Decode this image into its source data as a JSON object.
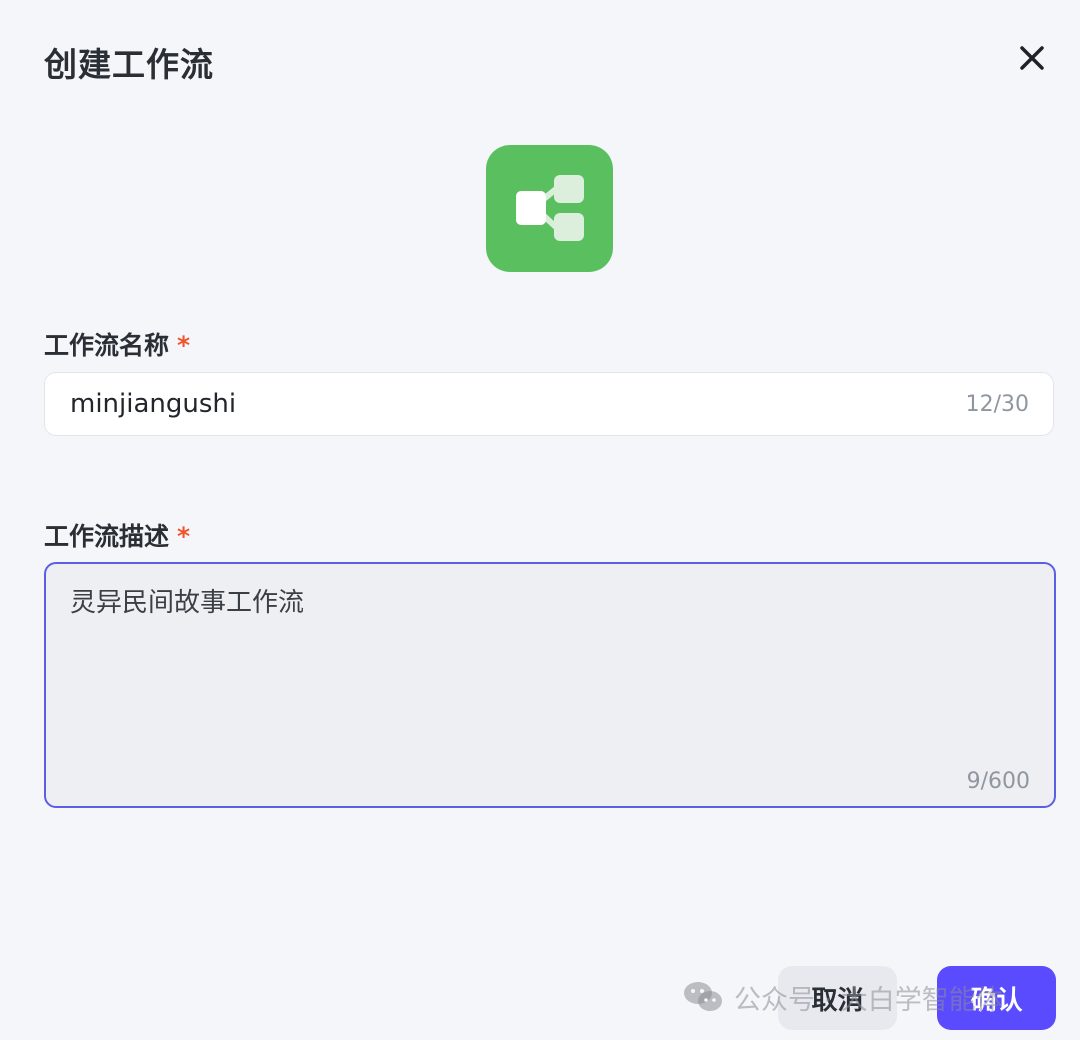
{
  "dialog": {
    "title": "创建工作流"
  },
  "icons": {
    "close": "close-icon",
    "app": "workflow-icon",
    "watermark": "wechat-icon"
  },
  "colors": {
    "app_icon_bg": "#5ac05f",
    "required_mark": "#f0542d",
    "focus_border": "#5b5fe3",
    "primary_button": "#5a4bff"
  },
  "name_field": {
    "label": "工作流名称",
    "required_mark": "*",
    "value": "minjiangushi",
    "counter": "12/30"
  },
  "desc_field": {
    "label": "工作流描述",
    "required_mark": "*",
    "value": "灵异民间故事工作流",
    "counter": "9/600"
  },
  "footer": {
    "cancel_label": "取消",
    "confirm_label": "确认"
  },
  "watermark": {
    "text": "公众号 · 大白学智能体"
  }
}
